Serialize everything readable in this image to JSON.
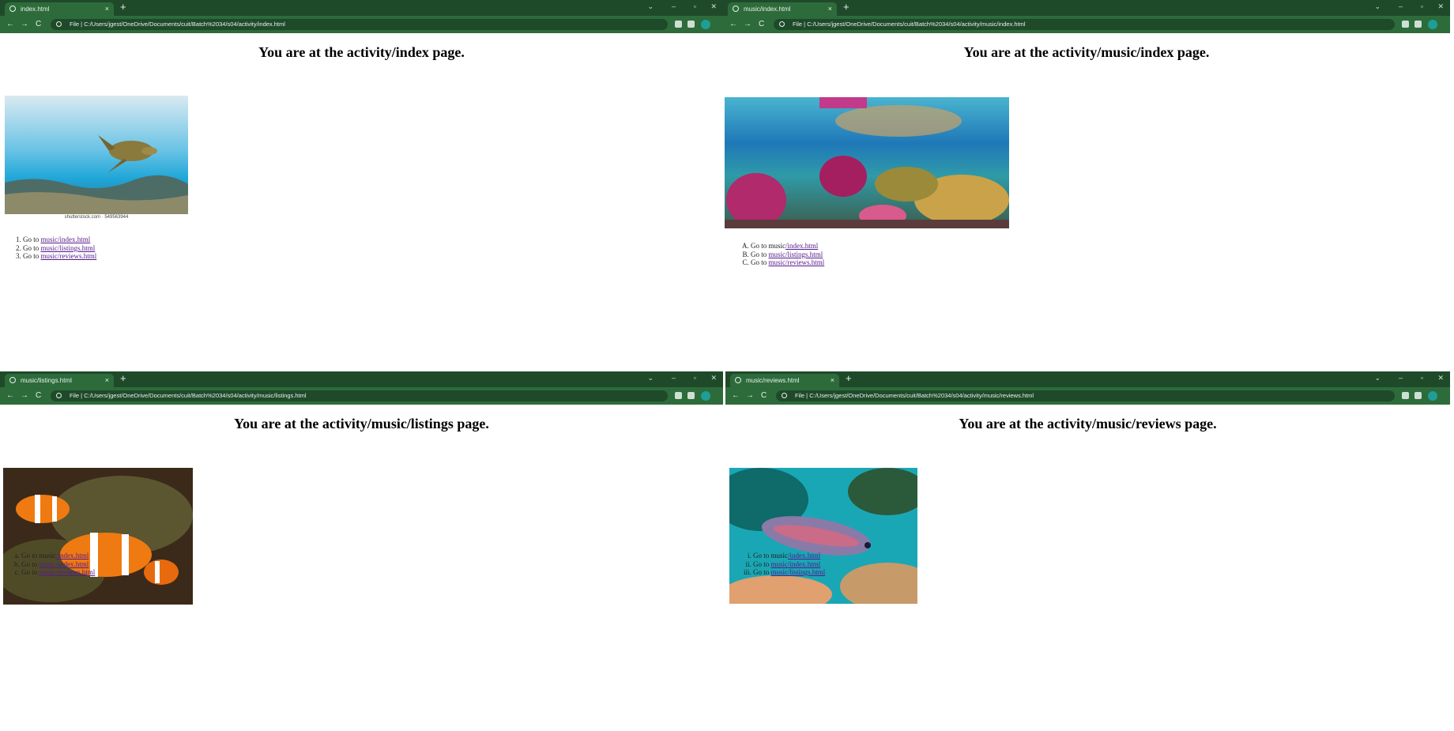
{
  "windows": [
    {
      "tab_title": "index.html",
      "url": "C:/Users/jgest/OneDrive/Documents/cuit/Batch%2034/s04/activity/index.html",
      "heading": "You are at the activity/index page.",
      "image_caption": "shutterstock.com · 549563944",
      "list_type": "1",
      "links": [
        {
          "prefix": "Go to ",
          "link": "music/index.html"
        },
        {
          "prefix": "Go to ",
          "link": "music/listings.html"
        },
        {
          "prefix": "Go to ",
          "link": "music/reviews.html"
        }
      ]
    },
    {
      "tab_title": "music/index.html",
      "url": "C:/Users/jgest/OneDrive/Documents/cuit/Batch%2034/s04/activity/music/index.html",
      "heading": "You are at the activity/music/index page.",
      "list_type": "A",
      "links": [
        {
          "prefix": "Go to music",
          "link": "/index.html"
        },
        {
          "prefix": "Go to ",
          "link": "music/listings.html"
        },
        {
          "prefix": "Go to ",
          "link": "music/reviews.html"
        }
      ]
    },
    {
      "tab_title": "music/listings.html",
      "url": "C:/Users/jgest/OneDrive/Documents/cuit/Batch%2034/s04/activity/music/listings.html",
      "heading": "You are at the activity/music/listings page.",
      "list_type": "a",
      "links": [
        {
          "prefix": "Go to music",
          "link": "/index.html"
        },
        {
          "prefix": "Go to ",
          "link": "music/index.html"
        },
        {
          "prefix": "Go to ",
          "link": "music/reviews.html"
        }
      ]
    },
    {
      "tab_title": "music/reviews.html",
      "url": "C:/Users/jgest/OneDrive/Documents/cuit/Batch%2034/s04/activity/music/reviews.html",
      "heading": "You are at the activity/music/reviews page.",
      "list_type": "i",
      "links": [
        {
          "prefix": "Go to music",
          "link": "/index.html"
        },
        {
          "prefix": "Go to ",
          "link": "music/index.html"
        },
        {
          "prefix": "Go to ",
          "link": "music/listings.html"
        }
      ]
    }
  ],
  "browser_ui": {
    "file_chip": "File",
    "new_tab": "+",
    "tab_close": "×",
    "back": "←",
    "forward": "→",
    "reload": "C",
    "minimize": "–",
    "maximize": "▫",
    "close": "✕",
    "tab_search": "⌄"
  },
  "colors": {
    "chrome_dark": "#1f4a2a",
    "chrome": "#2d6b3b",
    "link_visited": "#551a8b"
  },
  "images": [
    "sea-turtle",
    "coral-reef",
    "clownfish",
    "parrotfish"
  ]
}
